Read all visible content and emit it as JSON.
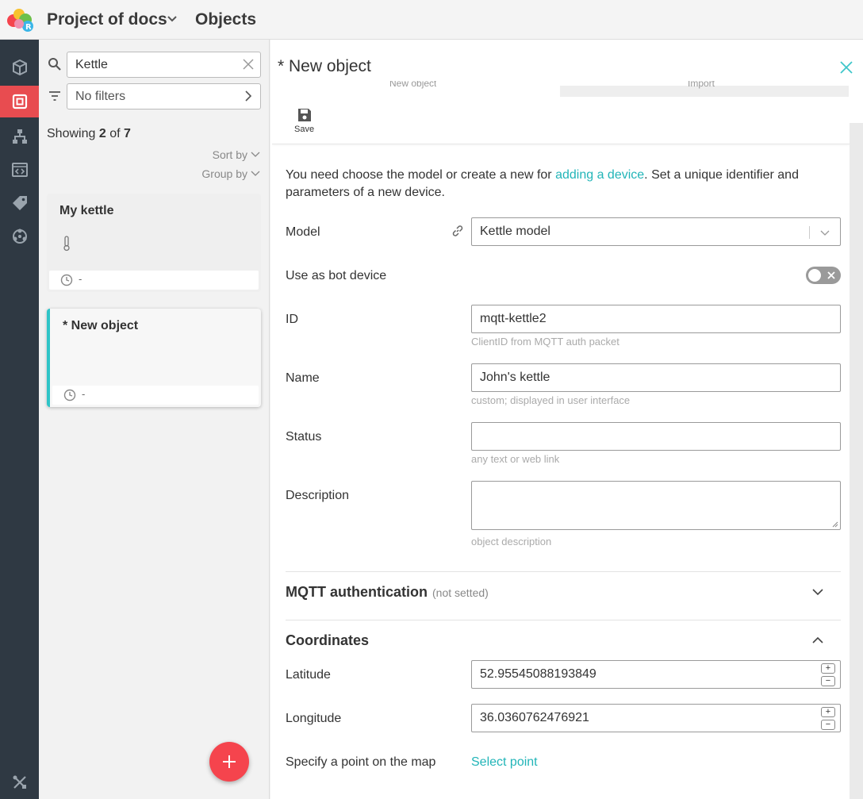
{
  "header": {
    "project_title": "Project of docs",
    "section_title": "Objects"
  },
  "rail": {
    "items": [
      "cube-icon",
      "objects-icon",
      "hierarchy-icon",
      "code-icon",
      "tag-icon",
      "network-icon",
      "tools-icon"
    ],
    "active": "objects-icon"
  },
  "list": {
    "search_value": "Kettle",
    "filter_text": "No filters",
    "showing_prefix": "Showing",
    "showing_count": "2",
    "showing_mid": "of",
    "showing_total": "7",
    "sort_by": "Sort by",
    "group_by": "Group by",
    "cards": [
      {
        "title": "My kettle",
        "time": "-"
      },
      {
        "title": "* New object",
        "time": "-"
      }
    ]
  },
  "form": {
    "title": "* New object",
    "tabs": [
      "New object",
      "Import"
    ],
    "save_label": "Save",
    "intro_before": "You need choose the model or create a new for ",
    "intro_link": "adding a device",
    "intro_after": ". Set a unique identifier and parameters of a new device.",
    "model_label": "Model",
    "model_value": "Kettle model",
    "bot_label": "Use as bot device",
    "bot_enabled": false,
    "id_label": "ID",
    "id_value": "mqtt-kettle2",
    "id_hint": "ClientID from MQTT auth packet",
    "name_label": "Name",
    "name_value": "John's kettle",
    "name_hint": "custom; displayed in user interface",
    "status_label": "Status",
    "status_value": "",
    "status_hint": "any text or web link",
    "description_label": "Description",
    "description_hint": "object description",
    "mqtt_title": "MQTT authentication",
    "mqtt_note": "(not setted)",
    "coords_title": "Coordinates",
    "latitude_label": "Latitude",
    "latitude_value": "52.95545088193849",
    "longitude_label": "Longitude",
    "longitude_value": "36.0360762476921",
    "map_label": "Specify a point on the map",
    "map_link": "Select point"
  },
  "colors": {
    "accent": "#22b5b8",
    "rail_active": "#e84c50",
    "rail_bg": "#2f3943",
    "fab": "#f5444d"
  }
}
